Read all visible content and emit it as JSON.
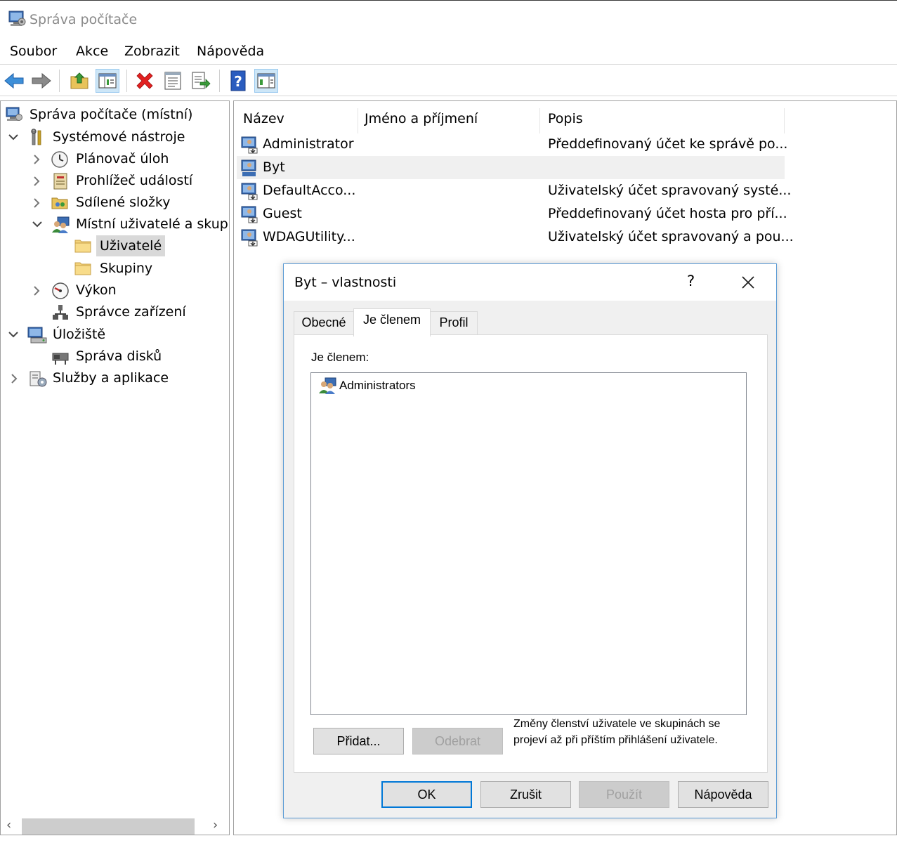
{
  "window": {
    "title": "Správa počítače"
  },
  "menu": [
    "Soubor",
    "Akce",
    "Zobrazit",
    "Nápověda"
  ],
  "toolbar": {
    "buttons": [
      "back-arrow-icon",
      "forward-arrow-icon",
      "up-folder-icon",
      "show-hide-tree-icon",
      "delete-icon",
      "properties-icon",
      "export-list-icon",
      "help-icon",
      "show-hide-action-pane-icon"
    ]
  },
  "tree": {
    "root": "Správa počítače (místní)",
    "system_tools": "Systémové nástroje",
    "task_scheduler": "Plánovač úloh",
    "event_viewer": "Prohlížeč událostí",
    "shared_folders": "Sdílené složky",
    "local_users": "Místní uživatelé a skupiny",
    "users": "Uživatelé",
    "groups": "Skupiny",
    "performance": "Výkon",
    "device_manager": "Správce zařízení",
    "storage": "Úložiště",
    "disk_management": "Správa disků",
    "services": "Služby a aplikace"
  },
  "list": {
    "columns": [
      "Název",
      "Jméno a příjmení",
      "Popis"
    ],
    "rows": [
      {
        "name": "Administrator",
        "fullname": "",
        "description": "Předdefinovaný účet ke správě po..."
      },
      {
        "name": "Byt",
        "fullname": "",
        "description": ""
      },
      {
        "name": "DefaultAcco...",
        "fullname": "",
        "description": "Uživatelský účet spravovaný systé..."
      },
      {
        "name": "Guest",
        "fullname": "",
        "description": "Předdefinovaný účet hosta pro pří..."
      },
      {
        "name": "WDAGUtility...",
        "fullname": "",
        "description": "Uživatelský účet spravovaný a pou..."
      }
    ],
    "selected_row": "Byt"
  },
  "dialog": {
    "title": "Byt – vlastnosti",
    "help_glyph": "?",
    "tabs": [
      "Obecné",
      "Je členem",
      "Profil"
    ],
    "active_tab": "Je členem",
    "member_label": "Je členem:",
    "members": [
      "Administrators"
    ],
    "add_button": "Přidat...",
    "remove_button": "Odebrat",
    "note": "Změny členství uživatele ve skupinách se projeví až při příštím přihlášení uživatele.",
    "ok_button": "OK",
    "cancel_button": "Zrušit",
    "apply_button": "Použít",
    "help_button": "Nápověda"
  }
}
